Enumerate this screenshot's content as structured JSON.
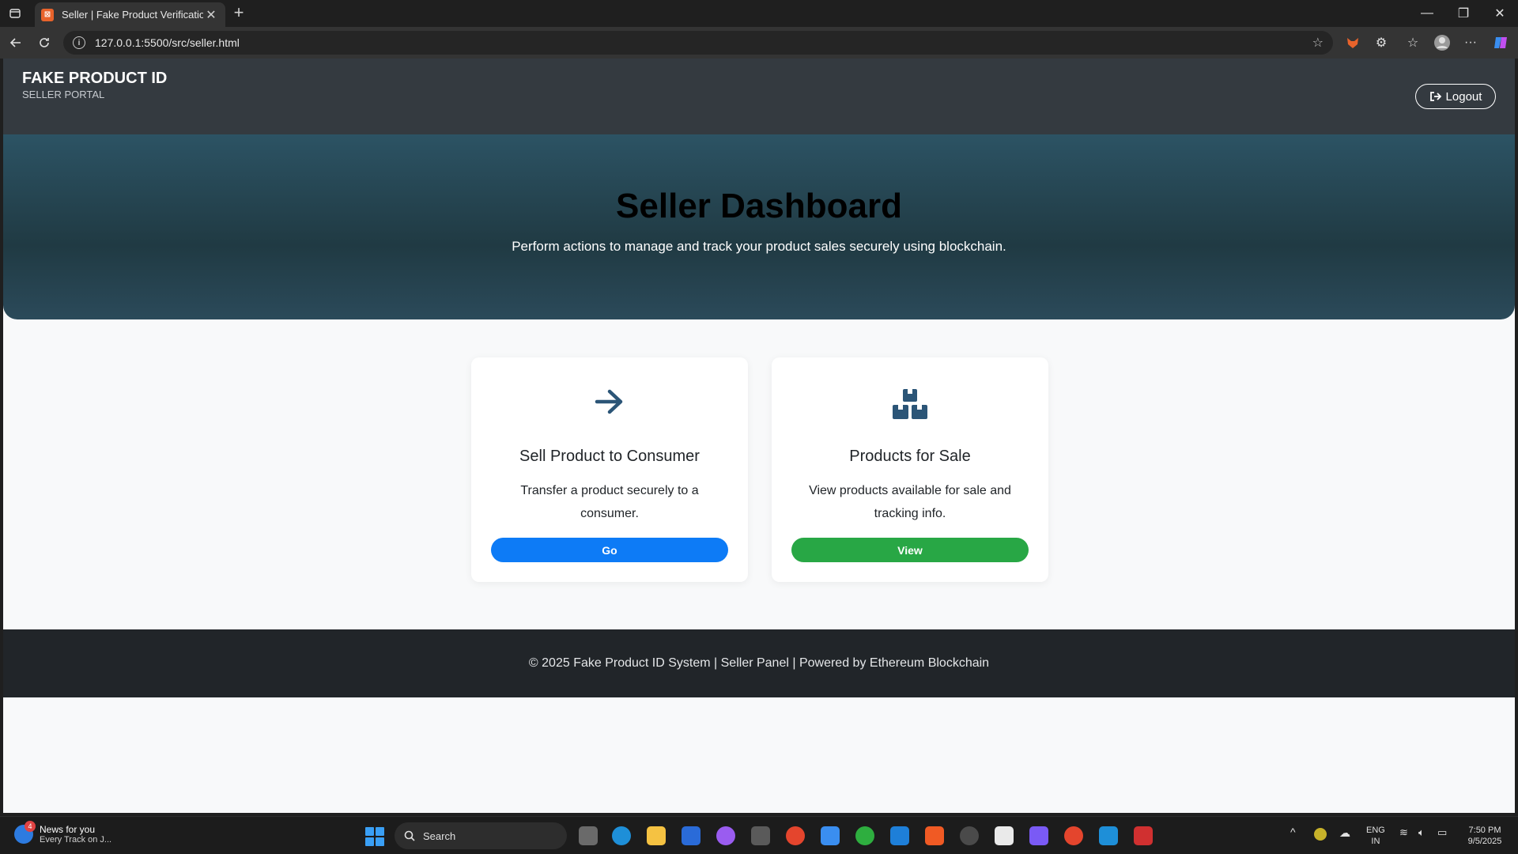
{
  "browser": {
    "tab_title": "Seller | Fake Product Verification",
    "url": "127.0.0.1:5500/src/seller.html"
  },
  "header": {
    "brand": "FAKE PRODUCT ID",
    "subtitle": "SELLER PORTAL",
    "logout_label": "Logout"
  },
  "hero": {
    "title": "Seller Dashboard",
    "subtitle": "Perform actions to manage and track your product sales securely using blockchain."
  },
  "cards": [
    {
      "icon": "arrow-right-icon",
      "title": "Sell Product to Consumer",
      "text": "Transfer a product securely to a consumer.",
      "button_label": "Go",
      "button_color": "#0d7bf6"
    },
    {
      "icon": "boxes-icon",
      "title": "Products for Sale",
      "text": "View products available for sale and tracking info.",
      "button_label": "View",
      "button_color": "#28a745"
    }
  ],
  "footer": {
    "text": "© 2025 Fake Product ID System | Seller Panel | Powered by Ethereum Blockchain"
  },
  "taskbar": {
    "news_badge": "4",
    "news_title": "News for you",
    "news_sub": "Every Track on J...",
    "search_label": "Search",
    "lang_top": "ENG",
    "lang_bottom": "IN",
    "time": "7:50 PM",
    "date": "9/5/2025"
  },
  "colors": {
    "header_bg": "#343a40",
    "icon_color": "#2b5577",
    "footer_bg": "#212529"
  }
}
